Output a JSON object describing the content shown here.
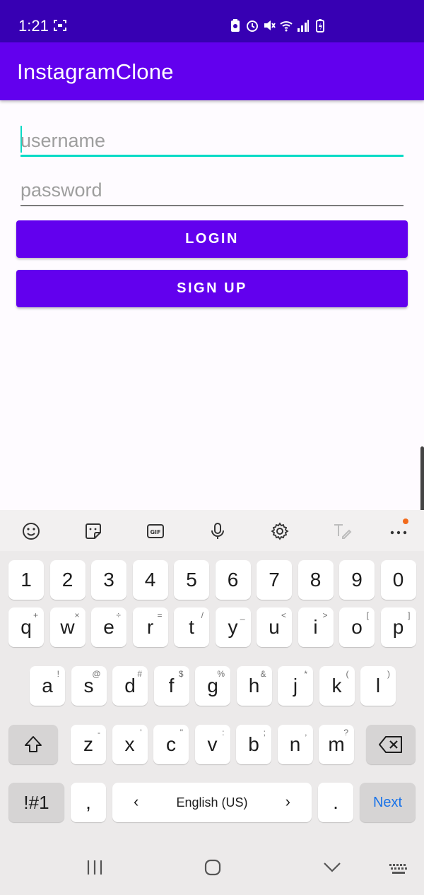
{
  "status_bar": {
    "time": "1:21"
  },
  "app_bar": {
    "title": "InstagramClone"
  },
  "form": {
    "username_placeholder": "username",
    "password_placeholder": "password",
    "login_label": "LOGIN",
    "signup_label": "SIGN UP"
  },
  "keyboard": {
    "number_row": [
      "1",
      "2",
      "3",
      "4",
      "5",
      "6",
      "7",
      "8",
      "9",
      "0"
    ],
    "row1": [
      {
        "key": "q",
        "sub": "+"
      },
      {
        "key": "w",
        "sub": "×"
      },
      {
        "key": "e",
        "sub": "÷"
      },
      {
        "key": "r",
        "sub": "="
      },
      {
        "key": "t",
        "sub": "/"
      },
      {
        "key": "y",
        "sub": "_"
      },
      {
        "key": "u",
        "sub": "<"
      },
      {
        "key": "i",
        "sub": ">"
      },
      {
        "key": "o",
        "sub": "["
      },
      {
        "key": "p",
        "sub": "]"
      }
    ],
    "row2": [
      {
        "key": "a",
        "sub": "!"
      },
      {
        "key": "s",
        "sub": "@"
      },
      {
        "key": "d",
        "sub": "#"
      },
      {
        "key": "f",
        "sub": "$"
      },
      {
        "key": "g",
        "sub": "%"
      },
      {
        "key": "h",
        "sub": "&"
      },
      {
        "key": "j",
        "sub": "*"
      },
      {
        "key": "k",
        "sub": "("
      },
      {
        "key": "l",
        "sub": ")"
      }
    ],
    "row3": [
      {
        "key": "z",
        "sub": "-"
      },
      {
        "key": "x",
        "sub": "'"
      },
      {
        "key": "c",
        "sub": "\""
      },
      {
        "key": "v",
        "sub": ":"
      },
      {
        "key": "b",
        "sub": ";"
      },
      {
        "key": "n",
        "sub": ","
      },
      {
        "key": "m",
        "sub": "?"
      }
    ],
    "symbols_label": "!#1",
    "comma_label": ",",
    "space_label": "English (US)",
    "space_left": "‹",
    "space_right": "›",
    "period_label": ".",
    "next_label": "Next"
  },
  "colors": {
    "primary": "#6200ee",
    "primary_dark": "#3700b3",
    "accent": "#03dac5",
    "next_key": "#1a73e8"
  }
}
